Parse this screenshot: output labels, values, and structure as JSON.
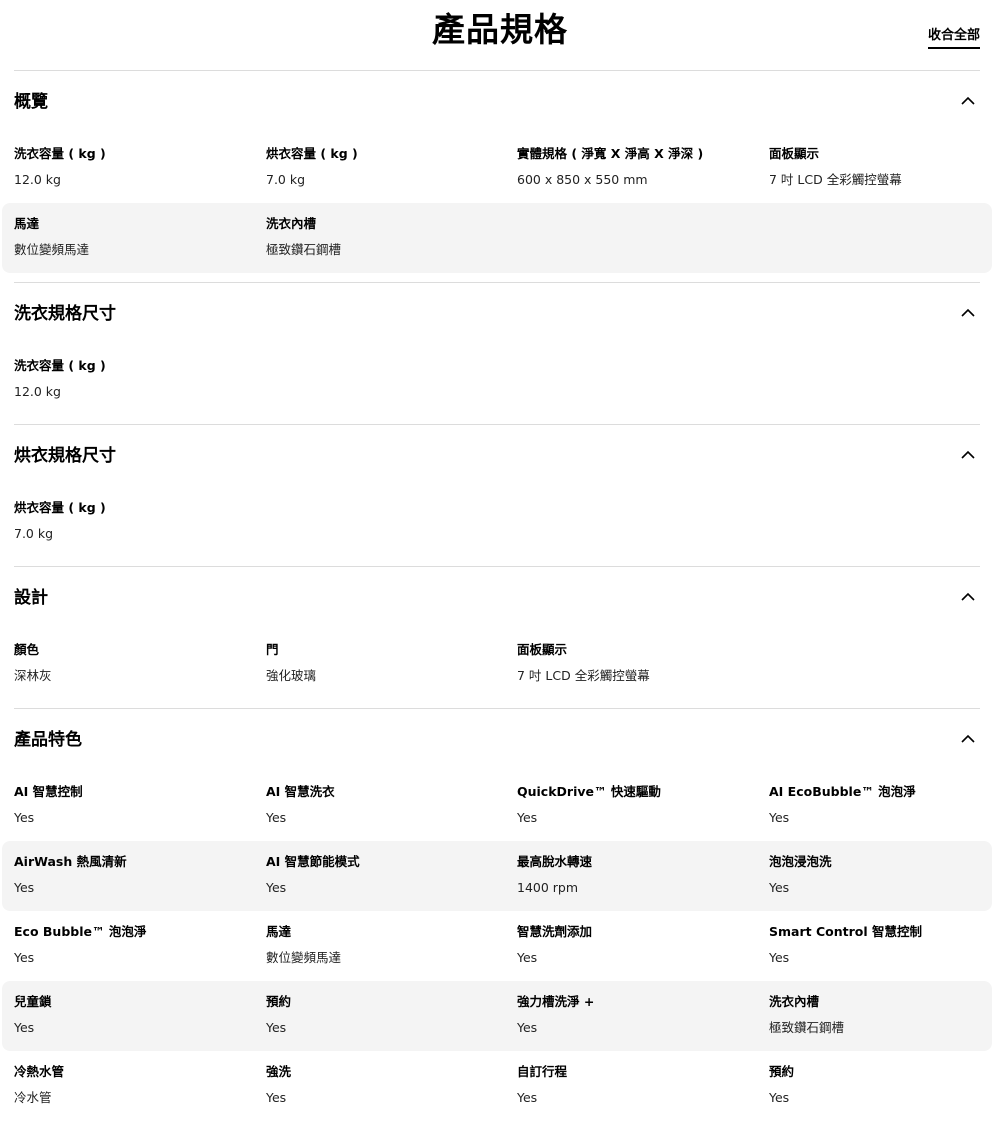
{
  "page_title": "產品規格",
  "collapse_all_label": "收合全部",
  "icons": {
    "section_toggle": "chevron-up-icon"
  },
  "sections": [
    {
      "title": "概覽",
      "rows": [
        [
          {
            "label": "洗衣容量 ( kg )",
            "value": "12.0 kg"
          },
          {
            "label": "烘衣容量 ( kg )",
            "value": "7.0 kg"
          },
          {
            "label": "實體規格 ( 淨寬 X 淨高 X 淨深 )",
            "value": "600 x 850 x 550 mm"
          },
          {
            "label": "面板顯示",
            "value": "7 吋 LCD 全彩觸控螢幕"
          }
        ],
        [
          {
            "label": "馬達",
            "value": "數位變頻馬達"
          },
          {
            "label": "洗衣內槽",
            "value": "極致鑽石鋼槽"
          }
        ]
      ]
    },
    {
      "title": "洗衣規格尺寸",
      "rows": [
        [
          {
            "label": "洗衣容量 ( kg )",
            "value": "12.0 kg"
          }
        ]
      ]
    },
    {
      "title": "烘衣規格尺寸",
      "rows": [
        [
          {
            "label": "烘衣容量 ( kg )",
            "value": "7.0 kg"
          }
        ]
      ]
    },
    {
      "title": "設計",
      "rows": [
        [
          {
            "label": "顏色",
            "value": "深林灰"
          },
          {
            "label": "門",
            "value": "強化玻璃"
          },
          {
            "label": "面板顯示",
            "value": "7 吋 LCD 全彩觸控螢幕"
          }
        ]
      ]
    },
    {
      "title": "產品特色",
      "rows": [
        [
          {
            "label": "AI 智慧控制",
            "value": "Yes"
          },
          {
            "label": "AI 智慧洗衣",
            "value": "Yes"
          },
          {
            "label": "QuickDrive™ 快速驅動",
            "value": "Yes"
          },
          {
            "label": "AI EcoBubble™ 泡泡淨",
            "value": "Yes"
          }
        ],
        [
          {
            "label": "AirWash 熱風清新",
            "value": "Yes"
          },
          {
            "label": "AI 智慧節能模式",
            "value": "Yes"
          },
          {
            "label": "最高脫水轉速",
            "value": "1400 rpm"
          },
          {
            "label": "泡泡浸泡洗",
            "value": "Yes"
          }
        ],
        [
          {
            "label": "Eco Bubble™ 泡泡淨",
            "value": "Yes"
          },
          {
            "label": "馬達",
            "value": "數位變頻馬達"
          },
          {
            "label": "智慧洗劑添加",
            "value": "Yes"
          },
          {
            "label": "Smart Control 智慧控制",
            "value": "Yes"
          }
        ],
        [
          {
            "label": "兒童鎖",
            "value": "Yes"
          },
          {
            "label": "預約",
            "value": "Yes"
          },
          {
            "label": "強力槽洗淨 +",
            "value": "Yes"
          },
          {
            "label": "洗衣內槽",
            "value": "極致鑽石鋼槽"
          }
        ],
        [
          {
            "label": "冷熱水管",
            "value": "冷水管"
          },
          {
            "label": "強洗",
            "value": "Yes"
          },
          {
            "label": "自訂行程",
            "value": "Yes"
          },
          {
            "label": "預約",
            "value": "Yes"
          }
        ]
      ]
    }
  ]
}
